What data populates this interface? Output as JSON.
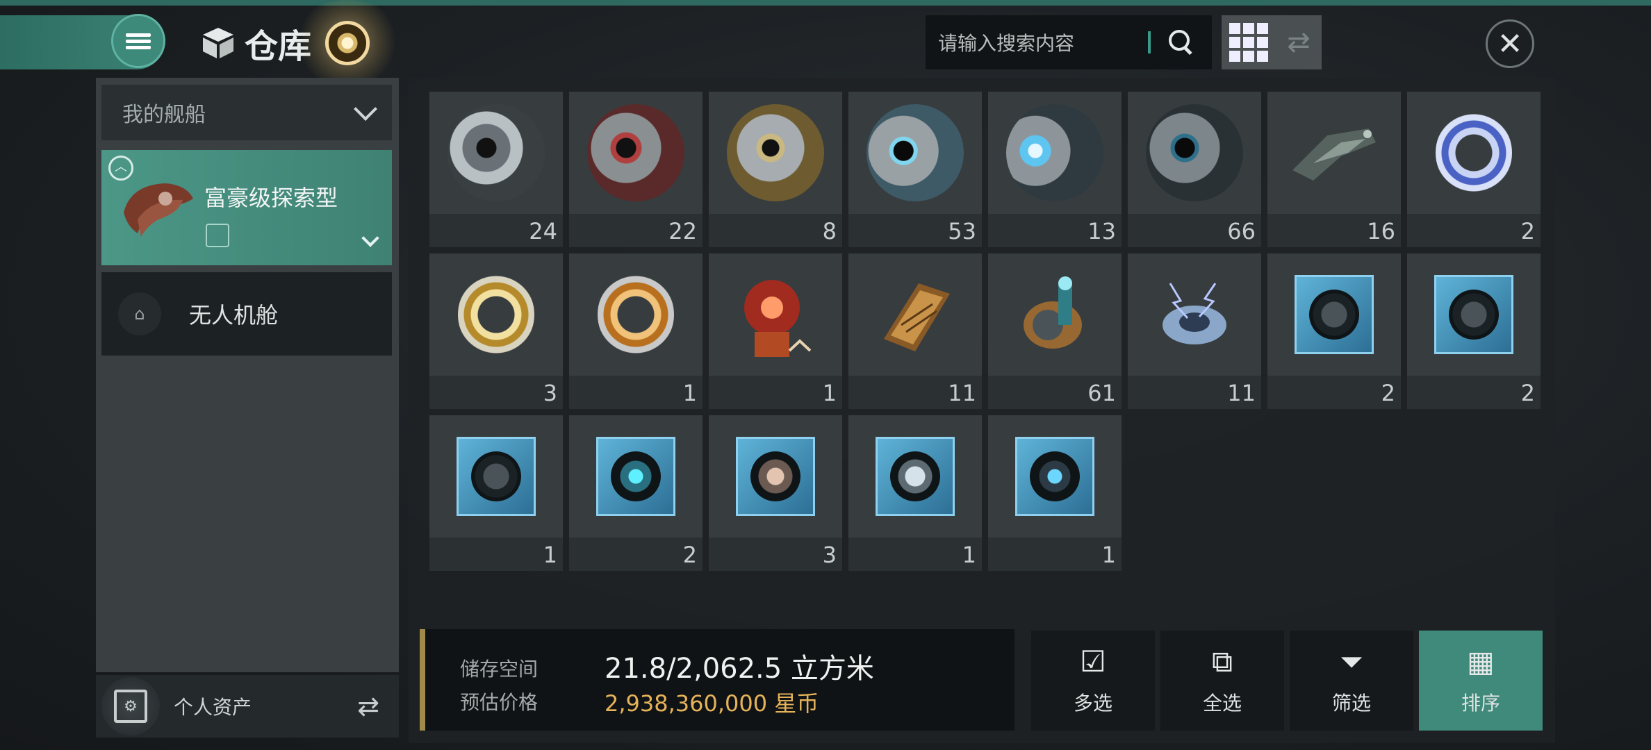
{
  "header": {
    "title": "仓库",
    "search_placeholder": "请输入搜索内容"
  },
  "sidebar": {
    "dropdown_label": "我的舰船",
    "ship_name": "富豪级探索型",
    "drone_bay_label": "无人机舱",
    "assets_label": "个人资产"
  },
  "inventory": {
    "items": [
      {
        "qty": "24"
      },
      {
        "qty": "22"
      },
      {
        "qty": "8"
      },
      {
        "qty": "53"
      },
      {
        "qty": "13"
      },
      {
        "qty": "66"
      },
      {
        "qty": "16"
      },
      {
        "qty": "2"
      },
      {
        "qty": "3"
      },
      {
        "qty": "1"
      },
      {
        "qty": "1"
      },
      {
        "qty": "11"
      },
      {
        "qty": "61"
      },
      {
        "qty": "11"
      },
      {
        "qty": "2"
      },
      {
        "qty": "2"
      },
      {
        "qty": "1"
      },
      {
        "qty": "2"
      },
      {
        "qty": "3"
      },
      {
        "qty": "1"
      },
      {
        "qty": "1"
      }
    ]
  },
  "storage": {
    "space_label": "储存空间",
    "space_value": "21.8/2,062.5 立方米",
    "price_label": "预估价格",
    "price_value": "2,938,360,000 星币"
  },
  "actions": {
    "multi_select": "多选",
    "select_all": "全选",
    "filter": "筛选",
    "sort": "排序"
  },
  "colors": {
    "accent": "#3f8a7a",
    "price": "#e6b35a"
  }
}
